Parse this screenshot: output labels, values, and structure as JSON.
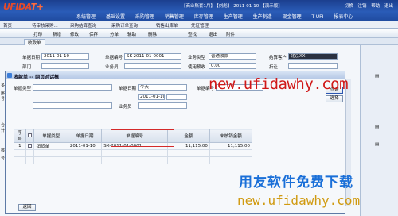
{
  "app": {
    "logo": "UFIDA",
    "logo_version": "T+",
    "status": [
      "【商业账套1月】",
      "【刘彪】",
      "2011-01-10",
      "【演示版】"
    ],
    "links": [
      "切换",
      "注销",
      "帮助",
      "退出"
    ],
    "menu": [
      "系统管理",
      "基础设置",
      "采购管理",
      "销售管理",
      "库存管理",
      "生产管理",
      "生产制造",
      "现金管理",
      "T-UFI",
      "报表中心"
    ]
  },
  "tabs1": [
    "首页",
    "待审核采购...",
    "采购结算查询",
    "采购订单查询",
    "销售出库单",
    "凭证管理"
  ],
  "toolbar": [
    "打印",
    "新增",
    "修改",
    "保存",
    "分单",
    "辅助",
    "删除",
    "查找",
    "退出",
    "附件"
  ],
  "doc_tab": "收款单",
  "form": {
    "doc_date_label": "单据日期",
    "doc_date": "2011-01-10",
    "doc_no_label": "单据编号",
    "doc_no": "SK-2011-01-0001",
    "biz_type_label": "业务类型",
    "biz_type": "普通收款",
    "customer_label": "结算客户",
    "customer": "北京XX",
    "dept_label": "部门",
    "staff_label": "业务员",
    "prepaid_label": "使用预收",
    "prepaid": "0.00",
    "discount_label": "折让"
  },
  "dialog": {
    "title": "收款单 -- 网页对话框",
    "doc_type_label": "单据类型",
    "doc_date_label": "单据日期",
    "doc_date_from": "今天",
    "doc_date_range": "2011-01-10",
    "doc_no_label": "单据编号",
    "staff_label": "业务员",
    "search_btn": "查询",
    "select_btn": "选择",
    "columns": [
      "序号",
      "",
      "单据类型",
      "单据日期",
      "单据编号",
      "金额",
      "未核销金额"
    ],
    "rows": [
      {
        "no": "1",
        "type": "销货单",
        "date": "2011-01-10",
        "code": "SX-2011-01-0001",
        "amount": "11,115.00",
        "open": "11,115.00"
      }
    ],
    "return_btn": "返回"
  },
  "side": {
    "labels": [
      "多",
      "序号",
      "合计",
      "核",
      "号"
    ]
  },
  "watermark": {
    "url_top": "new.ufidawhy.com",
    "cn": "用友软件免费下载",
    "url_bottom": "new.ufidawhy.com"
  }
}
